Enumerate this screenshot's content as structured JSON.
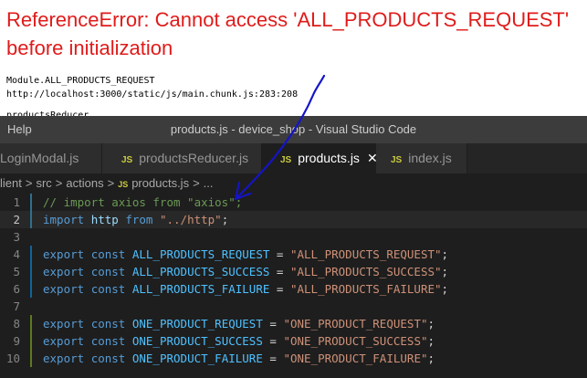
{
  "browser_error": {
    "title": "ReferenceError: Cannot access 'ALL_PRODUCTS_REQUEST' before initialization",
    "lines": [
      "Module.ALL_PRODUCTS_REQUEST",
      "http://localhost:3000/static/js/main.chunk.js:283:208",
      "productsReducer"
    ]
  },
  "titlebar": {
    "menu_help": "Help",
    "window_title": "products.js - device_shop - Visual Studio Code"
  },
  "tabs": [
    {
      "label": "LoginModal.js",
      "badge": "JS"
    },
    {
      "label": "productsReducer.js",
      "badge": "JS"
    },
    {
      "label": "products.js",
      "badge": "JS",
      "active": true,
      "close": "✕"
    },
    {
      "label": "index.js",
      "badge": "JS"
    }
  ],
  "breadcrumb": {
    "items": [
      "lient",
      "src",
      "actions"
    ],
    "badge": "JS",
    "file": "products.js",
    "ellipsis": "...",
    "separator": ">"
  },
  "editor": {
    "lines": [
      {
        "n": "1",
        "text": "// import axios from \"axios\";"
      },
      {
        "n": "2",
        "text": "import http from \"../http\";"
      },
      {
        "n": "3",
        "text": ""
      },
      {
        "n": "4",
        "text": "export const ALL_PRODUCTS_REQUEST = \"ALL_PRODUCTS_REQUEST\";"
      },
      {
        "n": "5",
        "text": "export const ALL_PRODUCTS_SUCCESS = \"ALL_PRODUCTS_SUCCESS\";"
      },
      {
        "n": "6",
        "text": "export const ALL_PRODUCTS_FAILURE = \"ALL_PRODUCTS_FAILURE\";"
      },
      {
        "n": "7",
        "text": ""
      },
      {
        "n": "8",
        "text": "export const ONE_PRODUCT_REQUEST = \"ONE_PRODUCT_REQUEST\";"
      },
      {
        "n": "9",
        "text": "export const ONE_PRODUCT_SUCCESS = \"ONE_PRODUCT_SUCCESS\";"
      },
      {
        "n": "10",
        "text": "export const ONE_PRODUCT_FAILURE = \"ONE_PRODUCT_FAILURE\";"
      }
    ]
  },
  "colors": {
    "error_red": "#e01b1b",
    "annotation_blue": "#1414c8",
    "js_badge": "#cbcb41",
    "editor_bg": "#1e1e1e"
  }
}
